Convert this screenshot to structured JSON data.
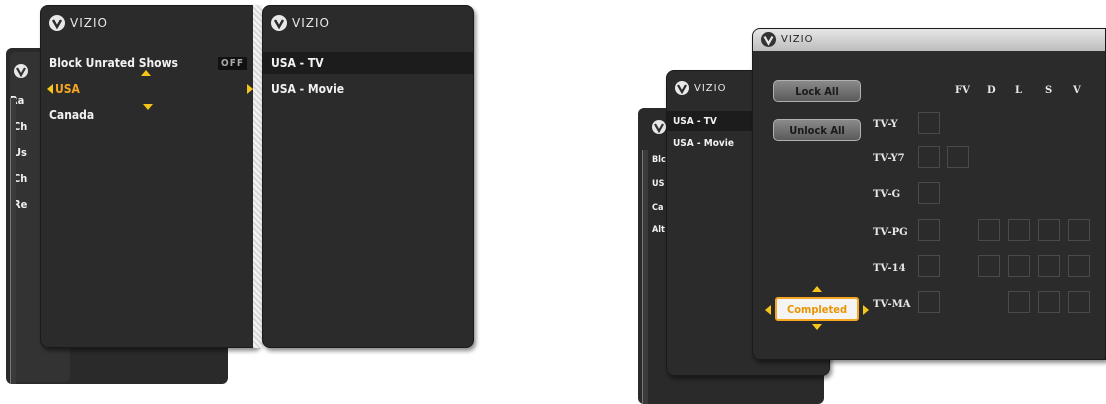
{
  "left_screen": {
    "brand": "VIZIO",
    "menu": {
      "block_unrated_label": "Block Unrated Shows",
      "block_unrated_value": "OFF",
      "usa_label": "USA",
      "canada_label": "Canada"
    },
    "submenu": {
      "brand": "VIZIO",
      "items": [
        "USA - TV",
        "USA - Movie"
      ]
    },
    "back_items": [
      "Ra",
      "Ch",
      "Us",
      "Ch",
      "Re"
    ]
  },
  "right_screen": {
    "brand": "VIZIO",
    "back_panel": {
      "brand": "VIZIO",
      "items": [
        "USA - TV",
        "USA - Movie"
      ]
    },
    "far_back_items": [
      "Blc",
      "US",
      "Ca",
      "Alt"
    ],
    "lock_all_label": "Lock All",
    "unlock_all_label": "Unlock All",
    "completed_label": "Completed",
    "column_headers": [
      "FV",
      "D",
      "L",
      "S",
      "V"
    ],
    "ratings": [
      "TV-Y",
      "TV-Y7",
      "TV-G",
      "TV-PG",
      "TV-14",
      "TV-MA"
    ]
  },
  "colors": {
    "panel": "#2b2b2b",
    "accent": "#f5a623",
    "arrow": "#f5c518"
  }
}
